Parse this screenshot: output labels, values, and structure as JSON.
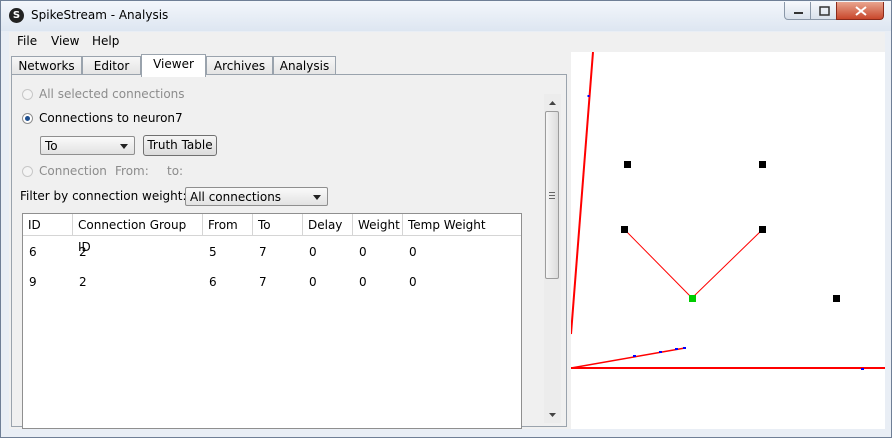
{
  "window": {
    "title": "SpikeStream - Analysis",
    "icon_letter": "S"
  },
  "menu": [
    "File",
    "View",
    "Help"
  ],
  "tabs": [
    {
      "label": "Networks",
      "active": false
    },
    {
      "label": "Editor",
      "active": false
    },
    {
      "label": "Viewer",
      "active": true
    },
    {
      "label": "Archives",
      "active": false
    },
    {
      "label": "Analysis",
      "active": false
    }
  ],
  "panel": {
    "all_selected": "All selected connections",
    "connections_to_neuron": "Connections to neuron",
    "neuron_id": "7",
    "direction_value": "To",
    "truth_table_button": "Truth Table",
    "connection_label": "Connection",
    "from_label": "From:",
    "to_label": "to:",
    "filter_label": "Filter by connection weight:",
    "filter_value": "All connections"
  },
  "table": {
    "headers": [
      "ID",
      "Connection Group ID",
      "From",
      "To",
      "Delay",
      "Weight",
      "Temp Weight"
    ],
    "rows": [
      [
        "6",
        "2",
        "5",
        "7",
        "0",
        "0",
        "0"
      ],
      [
        "9",
        "2",
        "6",
        "7",
        "0",
        "0",
        "0"
      ]
    ]
  },
  "colors": {
    "connection": "#ff0000",
    "neuron": "#000000",
    "selected_neuron": "#00cc00",
    "axis": "#ff0000",
    "axis_marker": "#0000ff"
  }
}
